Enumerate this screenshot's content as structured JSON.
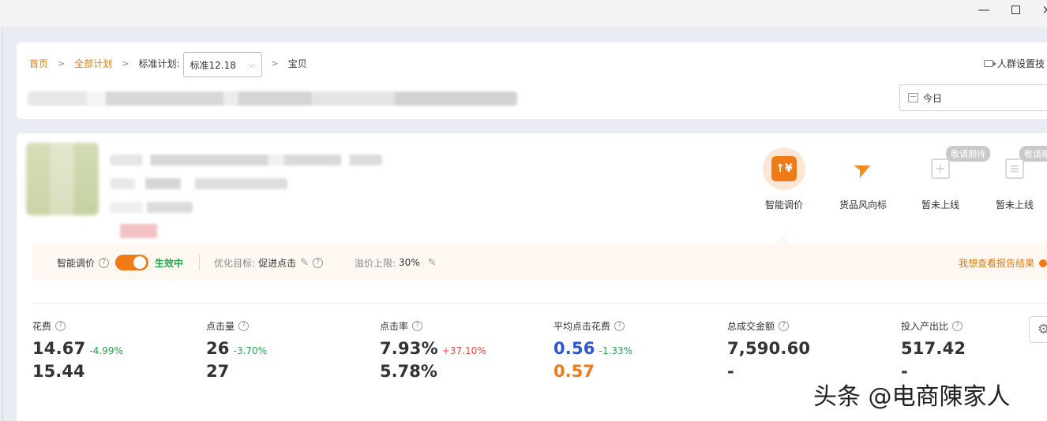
{
  "window": {
    "min_symbol": "—",
    "max_symbol": "",
    "close_symbol": "×"
  },
  "breadcrumb": {
    "home": "首页",
    "all_plans": "全部计划",
    "plan_label": "标准计划:",
    "plan_selected": "标准12.18",
    "current": "宝贝",
    "separator": ">"
  },
  "header": {
    "video_link": "人群设置技",
    "date_value": "今日"
  },
  "tools": [
    {
      "label": "智能调价",
      "icon": "smart-pricing-icon",
      "glyph": "↑¥"
    },
    {
      "label": "货品风向标",
      "icon": "paper-plane-icon",
      "glyph": "➤"
    },
    {
      "label": "暂未上线",
      "icon": "medical-kit-icon",
      "glyph": "+",
      "badge": "敬请期待"
    },
    {
      "label": "暂未上线",
      "icon": "clipboard-icon",
      "glyph": "≡",
      "badge": "敬请期"
    }
  ],
  "smart_strip": {
    "title": "智能调价",
    "status": "生效中",
    "toggle_on": true,
    "goal_label": "优化目标:",
    "goal_value": "促进点击",
    "premium_label": "溢价上限:",
    "premium_value": "30%",
    "report_link": "我想查看报告结果"
  },
  "metrics": [
    {
      "label": "花费",
      "value": "14.67",
      "change": "-4.99%",
      "change_dir": "down",
      "compare": "15.44"
    },
    {
      "label": "点击量",
      "value": "26",
      "change": "-3.70%",
      "change_dir": "down",
      "compare": "27"
    },
    {
      "label": "点击率",
      "value": "7.93%",
      "change": "+37.10%",
      "change_dir": "up",
      "compare": "5.78%"
    },
    {
      "label": "平均点击花费",
      "value": "0.56",
      "change": "-1.33%",
      "change_dir": "down",
      "compare": "0.57"
    },
    {
      "label": "总成交金额",
      "value": "7,590.60",
      "change": "",
      "compare": "-"
    },
    {
      "label": "投入产出比",
      "value": "517.42",
      "change": "",
      "compare": "-"
    }
  ],
  "colors": {
    "accent": "#f07a16",
    "link": "#d7801f",
    "positive": "#25a34f",
    "negative": "#e1493d",
    "blue": "#2c56d1"
  },
  "watermark": "头条 @电商陳家人"
}
